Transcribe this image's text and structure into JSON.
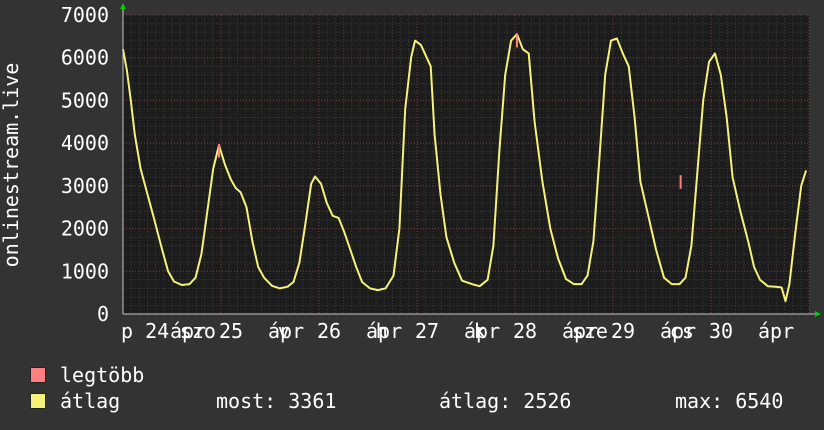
{
  "chart_data": {
    "type": "line",
    "ylabel": "onlinestream.live",
    "ylim": [
      0,
      7000
    ],
    "yticks": [
      0,
      1000,
      2000,
      3000,
      4000,
      5000,
      6000,
      7000
    ],
    "xlim": [
      0,
      7
    ],
    "xticks": [
      {
        "x": 0.0,
        "label": "p 24"
      },
      {
        "x": 0.5,
        "label": "ápr"
      },
      {
        "x": 0.6,
        "label": "szo"
      },
      {
        "x": 1.0,
        "label": "25"
      },
      {
        "x": 1.5,
        "label": "ápr"
      },
      {
        "x": 1.6,
        "label": "v"
      },
      {
        "x": 2.0,
        "label": "26"
      },
      {
        "x": 2.5,
        "label": "ápr"
      },
      {
        "x": 2.6,
        "label": "h"
      },
      {
        "x": 3.0,
        "label": "27"
      },
      {
        "x": 3.5,
        "label": "ápr"
      },
      {
        "x": 3.6,
        "label": "k"
      },
      {
        "x": 4.0,
        "label": "28"
      },
      {
        "x": 4.5,
        "label": "ápr"
      },
      {
        "x": 4.6,
        "label": "sze"
      },
      {
        "x": 5.0,
        "label": "29"
      },
      {
        "x": 5.5,
        "label": "ápr"
      },
      {
        "x": 5.6,
        "label": "cs"
      },
      {
        "x": 6.0,
        "label": "30"
      },
      {
        "x": 6.5,
        "label": "ápr"
      }
    ],
    "grid": true,
    "series": [
      {
        "name": "átlag",
        "color": "#f5f27a",
        "points": [
          [
            0.0,
            6200
          ],
          [
            0.04,
            5700
          ],
          [
            0.08,
            5000
          ],
          [
            0.12,
            4200
          ],
          [
            0.18,
            3400
          ],
          [
            0.25,
            2800
          ],
          [
            0.32,
            2200
          ],
          [
            0.4,
            1500
          ],
          [
            0.46,
            1000
          ],
          [
            0.52,
            760
          ],
          [
            0.6,
            680
          ],
          [
            0.68,
            700
          ],
          [
            0.74,
            850
          ],
          [
            0.8,
            1400
          ],
          [
            0.86,
            2400
          ],
          [
            0.92,
            3400
          ],
          [
            0.98,
            3950
          ],
          [
            1.04,
            3500
          ],
          [
            1.1,
            3150
          ],
          [
            1.15,
            2950
          ],
          [
            1.2,
            2850
          ],
          [
            1.26,
            2500
          ],
          [
            1.32,
            1700
          ],
          [
            1.38,
            1100
          ],
          [
            1.44,
            850
          ],
          [
            1.52,
            660
          ],
          [
            1.6,
            600
          ],
          [
            1.68,
            640
          ],
          [
            1.74,
            750
          ],
          [
            1.8,
            1200
          ],
          [
            1.86,
            2100
          ],
          [
            1.92,
            3050
          ],
          [
            1.96,
            3220
          ],
          [
            2.02,
            3050
          ],
          [
            2.08,
            2600
          ],
          [
            2.14,
            2300
          ],
          [
            2.2,
            2250
          ],
          [
            2.26,
            1900
          ],
          [
            2.32,
            1500
          ],
          [
            2.38,
            1100
          ],
          [
            2.44,
            750
          ],
          [
            2.52,
            600
          ],
          [
            2.6,
            560
          ],
          [
            2.68,
            600
          ],
          [
            2.76,
            900
          ],
          [
            2.82,
            2000
          ],
          [
            2.88,
            4800
          ],
          [
            2.94,
            6000
          ],
          [
            2.98,
            6400
          ],
          [
            3.04,
            6300
          ],
          [
            3.08,
            6100
          ],
          [
            3.14,
            5800
          ],
          [
            3.18,
            4200
          ],
          [
            3.24,
            2800
          ],
          [
            3.3,
            1800
          ],
          [
            3.38,
            1200
          ],
          [
            3.46,
            780
          ],
          [
            3.56,
            700
          ],
          [
            3.64,
            650
          ],
          [
            3.72,
            800
          ],
          [
            3.78,
            1600
          ],
          [
            3.84,
            3800
          ],
          [
            3.9,
            5600
          ],
          [
            3.96,
            6400
          ],
          [
            4.02,
            6550
          ],
          [
            4.08,
            6200
          ],
          [
            4.14,
            6100
          ],
          [
            4.2,
            4500
          ],
          [
            4.28,
            3100
          ],
          [
            4.36,
            2000
          ],
          [
            4.44,
            1300
          ],
          [
            4.52,
            820
          ],
          [
            4.6,
            700
          ],
          [
            4.68,
            700
          ],
          [
            4.74,
            900
          ],
          [
            4.8,
            1700
          ],
          [
            4.86,
            3600
          ],
          [
            4.92,
            5600
          ],
          [
            4.98,
            6400
          ],
          [
            5.04,
            6450
          ],
          [
            5.1,
            6100
          ],
          [
            5.16,
            5800
          ],
          [
            5.22,
            4600
          ],
          [
            5.28,
            3100
          ],
          [
            5.36,
            2300
          ],
          [
            5.44,
            1500
          ],
          [
            5.52,
            850
          ],
          [
            5.6,
            700
          ],
          [
            5.68,
            700
          ],
          [
            5.74,
            850
          ],
          [
            5.8,
            1600
          ],
          [
            5.86,
            3300
          ],
          [
            5.92,
            5000
          ],
          [
            5.98,
            5900
          ],
          [
            6.04,
            6100
          ],
          [
            6.1,
            5600
          ],
          [
            6.16,
            4600
          ],
          [
            6.22,
            3200
          ],
          [
            6.3,
            2400
          ],
          [
            6.38,
            1700
          ],
          [
            6.44,
            1100
          ],
          [
            6.5,
            800
          ],
          [
            6.58,
            650
          ],
          [
            6.66,
            640
          ],
          [
            6.72,
            620
          ],
          [
            6.76,
            300
          ],
          [
            6.8,
            700
          ],
          [
            6.86,
            1900
          ],
          [
            6.92,
            3000
          ],
          [
            6.97,
            3361
          ]
        ]
      },
      {
        "name": "legtöbb",
        "color": "#ff7f7f",
        "spikes": [
          [
            0.98,
            3980
          ],
          [
            4.02,
            6560
          ],
          [
            5.69,
            3250
          ]
        ]
      }
    ]
  },
  "legend": {
    "max_label": "legtöbb",
    "max_color": "#ff7f7f",
    "avg_label": "átlag",
    "avg_color": "#f5f27a"
  },
  "stats": {
    "now": "most: 3361",
    "avg": "átlag: 2526",
    "max": "max: 6540"
  }
}
